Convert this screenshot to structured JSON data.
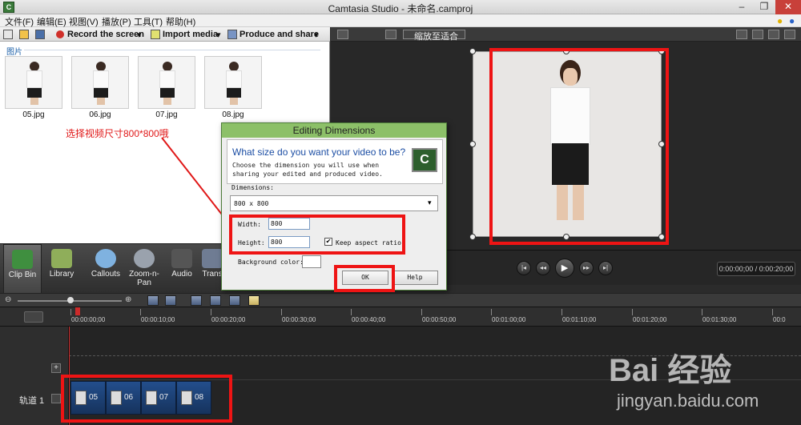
{
  "window": {
    "title": "Camtasia Studio - 未命名.camproj"
  },
  "menu": [
    "文件(F)",
    "编辑(E)",
    "视图(V)",
    "播放(P)",
    "工具(T)",
    "帮助(H)"
  ],
  "toolbar": {
    "record": "Record the screen",
    "import": "Import media",
    "produce": "Produce and share"
  },
  "clipbin": {
    "group": "图片",
    "items": [
      "05.jpg",
      "06.jpg",
      "07.jpg",
      "08.jpg"
    ]
  },
  "annotation": "选择视频尺寸800*800哦",
  "preview": {
    "zoom": "缩放至适合",
    "timecode": "0:00:00;00 / 0:00:20;00"
  },
  "tabs": [
    "Clip Bin",
    "Library",
    "Callouts",
    "Zoom-n-Pan",
    "Audio",
    "Trans"
  ],
  "timeline": {
    "ticks": [
      "00:00:00;00",
      "00:00:10;00",
      "00:00:20;00",
      "00:00:30;00",
      "00:00:40;00",
      "00:00:50;00",
      "00:01:00;00",
      "00:01:10;00",
      "00:01:20;00",
      "00:01:30;00",
      "00:0"
    ],
    "track_label": "轨道 1",
    "clips": [
      "05",
      "06",
      "07",
      "08"
    ]
  },
  "dialog": {
    "title": "Editing Dimensions",
    "question": "What size do you want your video to be?",
    "description": "Choose the dimension you will use when sharing your edited and produced video.",
    "dimensions_label": "Dimensions:",
    "dimensions_value": "800 x 800",
    "width_label": "Width:",
    "width_value": "800",
    "height_label": "Height:",
    "height_value": "800",
    "keep_aspect": "Keep aspect ratio",
    "keep_aspect_checked": true,
    "bg_label": "Background color:",
    "ok": "OK",
    "help": "Help"
  },
  "watermark": {
    "logo": "Bai 经验",
    "url": "jingyan.baidu.com"
  },
  "colors": {
    "highlight": "#ee1414",
    "dialog_title": "#8cc068",
    "clip": "#234e8c"
  }
}
